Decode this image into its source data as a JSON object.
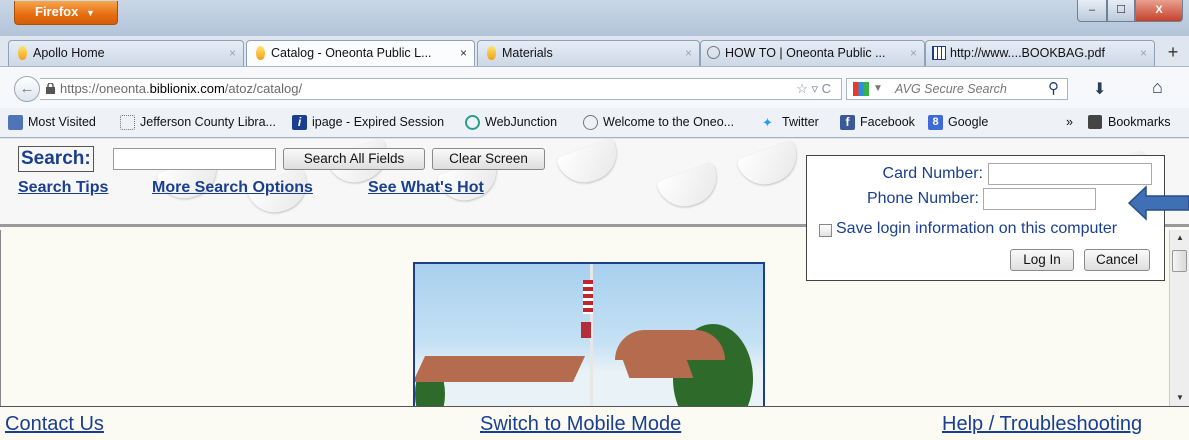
{
  "browser": {
    "menu_button": "Firefox",
    "window_controls": {
      "minimize": "–",
      "maximize": "☐",
      "close": "X"
    }
  },
  "tabs": [
    {
      "label": "Apollo Home",
      "icon": "flame-icon"
    },
    {
      "label": "Catalog - Oneonta Public L...",
      "icon": "flame-icon",
      "active": true
    },
    {
      "label": "Materials",
      "icon": "flame-icon"
    },
    {
      "label": "HOW TO | Oneonta Public ...",
      "icon": "circle-icon"
    },
    {
      "label": "http://www....BOOKBAG.pdf",
      "icon": "grid-icon"
    }
  ],
  "tab_close": "×",
  "new_tab": "+",
  "address": {
    "prefix": "https://oneonta.",
    "domain": "biblionix.com",
    "path": "/atoz/catalog/",
    "icons": "☆ ▿ C"
  },
  "search_engine": {
    "placeholder": "AVG Secure Search"
  },
  "bookmarks": [
    {
      "label": "Most Visited",
      "icon": "bookmark-page-icon"
    },
    {
      "label": "Jefferson County Libra...",
      "icon": "dotted-square-icon"
    },
    {
      "label": "ipage - Expired Session",
      "icon": "info-icon"
    },
    {
      "label": "WebJunction",
      "icon": "webjunction-icon"
    },
    {
      "label": "Welcome to the Oneo...",
      "icon": "circle-icon"
    },
    {
      "label": "Twitter",
      "icon": "twitter-bird-icon"
    },
    {
      "label": "Facebook",
      "icon": "facebook-icon"
    },
    {
      "label": "Google",
      "icon": "google-icon"
    }
  ],
  "bookmarks_menu": "Bookmarks",
  "bookmarks_more": "»",
  "catalog": {
    "search_label": "Search:",
    "search_all_button": "Search All Fields",
    "clear_button": "Clear Screen",
    "links": {
      "tips": "Search Tips",
      "more_options": "More Search Options",
      "whats_hot": "See What's Hot"
    }
  },
  "login": {
    "card_label": "Card Number:",
    "phone_label": "Phone Number:",
    "save_label": "Save login information on this computer",
    "login_button": "Log In",
    "cancel_button": "Cancel"
  },
  "footer": {
    "contact": "Contact Us",
    "mobile": "Switch to Mobile Mode",
    "help": "Help / Troubleshooting"
  },
  "colors": {
    "link_blue": "#1a3f8f",
    "firefox_orange": "#e66c10",
    "arrow_blue": "#3f6fb5"
  }
}
